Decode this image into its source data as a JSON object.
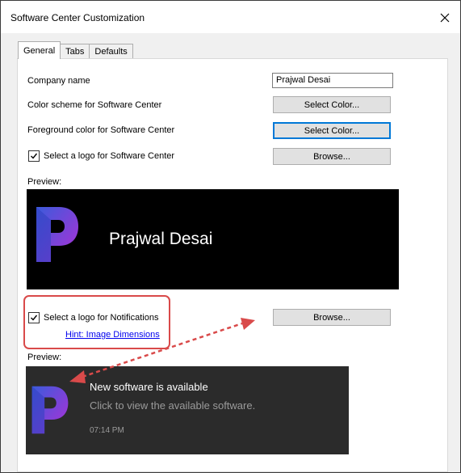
{
  "window": {
    "title": "Software Center Customization"
  },
  "tabs": [
    {
      "label": "General",
      "active": true
    },
    {
      "label": "Tabs",
      "active": false
    },
    {
      "label": "Defaults",
      "active": false
    }
  ],
  "general": {
    "company_name_label": "Company name",
    "company_name_value": "Prajwal Desai",
    "color_scheme_label": "Color scheme for Software Center",
    "color_scheme_button": "Select Color...",
    "foreground_label": "Foreground color for Software Center",
    "foreground_button": "Select Color...",
    "logo_checkbox_label": "Select a logo for Software Center",
    "logo_checked": true,
    "logo_browse_button": "Browse...",
    "preview_label": "Preview:",
    "preview_brand_text": "Prajwal Desai",
    "notif_checkbox_label": "Select a logo for Notifications",
    "notif_checked": true,
    "notif_browse_button": "Browse...",
    "hint_link": "Hint: Image Dimensions",
    "notif_preview_label": "Preview:",
    "notification": {
      "title": "New software is available",
      "body": "Click to view the available software.",
      "time": "07:14 PM"
    }
  },
  "colors": {
    "logo_gradient_start": "#3b5bdb",
    "logo_gradient_end": "#b02fd6",
    "annotation_red": "#d94a4a",
    "focus_blue": "#0078d7"
  },
  "icons": {
    "close": "close-icon",
    "checkmark": "checkmark-icon",
    "logo": "p-logo-icon"
  }
}
